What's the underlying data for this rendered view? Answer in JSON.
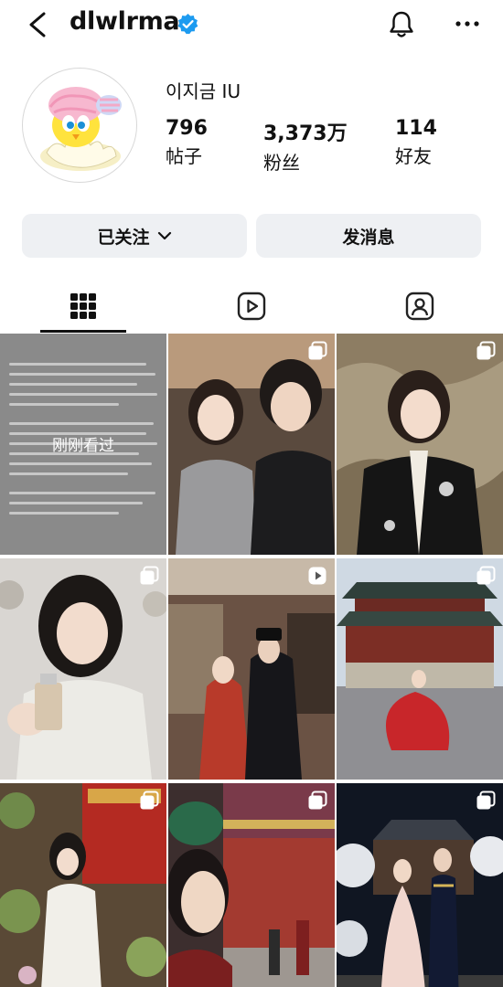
{
  "header": {
    "username": "dlwlrma",
    "back_icon": "chevron-left-icon",
    "verified_icon": "verified-badge-icon",
    "notification_icon": "bell-icon",
    "more_icon": "more-horizontal-icon"
  },
  "profile": {
    "display_name": "이지금 IU",
    "stats": [
      {
        "value": "796",
        "label": "帖子"
      },
      {
        "value": "3,373万",
        "label": "粉丝"
      },
      {
        "value": "114",
        "label": "好友"
      }
    ]
  },
  "actions": {
    "follow_label": "已关注",
    "message_label": "发消息"
  },
  "tabs": [
    "grid-icon",
    "reels-icon",
    "tagged-icon"
  ],
  "grid": {
    "seen_label": "刚刚看过",
    "posts": [
      {
        "kind": "text-notice",
        "badge": ""
      },
      {
        "kind": "selfie-pair",
        "badge": "carousel-icon"
      },
      {
        "kind": "portrait-painting",
        "badge": "carousel-icon"
      },
      {
        "kind": "product-portrait",
        "badge": "carousel-icon"
      },
      {
        "kind": "drama-scene",
        "badge": "reel-icon"
      },
      {
        "kind": "palace-hanbok",
        "badge": "carousel-icon"
      },
      {
        "kind": "flower-set",
        "badge": "carousel-icon"
      },
      {
        "kind": "palace-street",
        "badge": "carousel-icon"
      },
      {
        "kind": "wedding-night",
        "badge": "carousel-icon"
      }
    ]
  },
  "colors": {
    "verified": "#1d9bf0",
    "button_bg": "#eef0f3"
  }
}
